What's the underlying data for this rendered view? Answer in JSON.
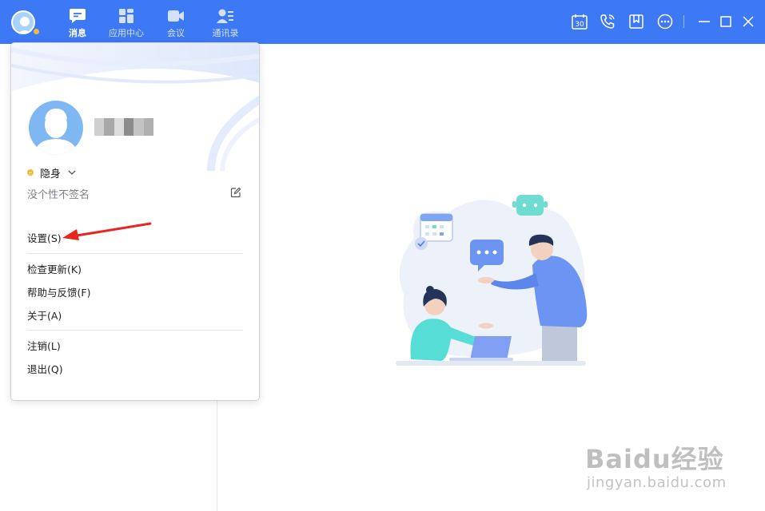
{
  "topbar": {
    "tabs": [
      {
        "label": "消息",
        "icon": "chat-bubble-icon",
        "active": true
      },
      {
        "label": "应用中心",
        "icon": "app-grid-icon",
        "active": false
      },
      {
        "label": "会议",
        "icon": "video-camera-icon",
        "active": false
      },
      {
        "label": "通讯录",
        "icon": "contacts-icon",
        "active": false
      }
    ],
    "calendar_day": "30",
    "accent": "#3d78f5"
  },
  "popup": {
    "status_label": "隐身",
    "status_color": "#f5b83d",
    "signature": "没个性不签名",
    "menu": {
      "settings": "设置(S)",
      "check_update": "检查更新(K)",
      "help_feedback": "帮助与反馈(F)",
      "about": "关于(A)",
      "logout": "注销(L)",
      "quit": "退出(Q)"
    }
  },
  "watermark": {
    "brand": "Baidu经验",
    "url": "jingyan.baidu.com"
  }
}
